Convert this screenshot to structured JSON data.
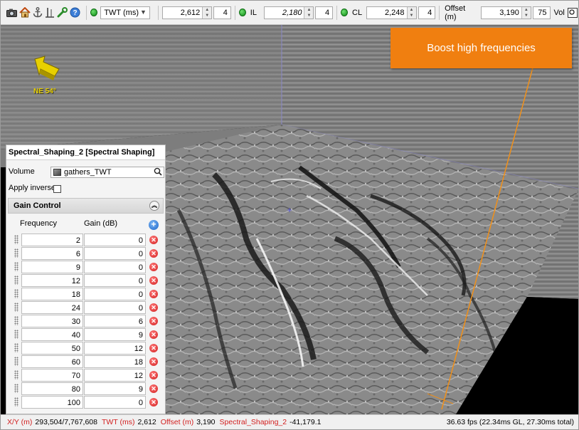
{
  "toolbar": {
    "domain_select": "TWT (ms)",
    "twt_value": "2,612",
    "twt_step": "4",
    "il_label": "IL",
    "il_value": "2,180",
    "il_step": "4",
    "cl_label": "CL",
    "cl_value": "2,248",
    "cl_step": "4",
    "offset_label": "Offset (m)",
    "offset_value": "3,190",
    "offset_step": "75",
    "vol_label": "Vol"
  },
  "viewport": {
    "callout": "Boost high frequencies",
    "compass_label": "NE 54°"
  },
  "panel": {
    "title": "Spectral_Shaping_2 [Spectral Shaping]",
    "volume_label": "Volume",
    "volume_value": "gathers_TWT",
    "apply_inverse_label": "Apply inverse",
    "apply_inverse_checked": false,
    "gain_section": "Gain Control",
    "col_frequency": "Frequency",
    "col_gain": "Gain (dB)",
    "rows": [
      {
        "frequency": "2",
        "gain": "0"
      },
      {
        "frequency": "6",
        "gain": "0"
      },
      {
        "frequency": "9",
        "gain": "0"
      },
      {
        "frequency": "12",
        "gain": "0"
      },
      {
        "frequency": "18",
        "gain": "0"
      },
      {
        "frequency": "24",
        "gain": "0"
      },
      {
        "frequency": "30",
        "gain": "6"
      },
      {
        "frequency": "40",
        "gain": "9"
      },
      {
        "frequency": "50",
        "gain": "12"
      },
      {
        "frequency": "60",
        "gain": "18"
      },
      {
        "frequency": "70",
        "gain": "12"
      },
      {
        "frequency": "80",
        "gain": "9"
      },
      {
        "frequency": "100",
        "gain": "0"
      }
    ]
  },
  "status": {
    "xy_label": "X/Y (m)",
    "xy_value": "293,504/7,767,608",
    "twt_label": "TWT (ms)",
    "twt_value": "2,612",
    "offset_label": "Offset (m)",
    "offset_value": "3,190",
    "attr_label": "Spectral_Shaping_2",
    "attr_value": "-41,179.1",
    "fps": "36.63 fps (22.34ms GL, 27.30ms total)"
  },
  "colors": {
    "callout_bg": "#f07f10",
    "status_label": "#d21f1f",
    "indicator_green": "#0e8a16",
    "compass_yellow": "#e8d000",
    "well_trace": "#f0901a"
  }
}
